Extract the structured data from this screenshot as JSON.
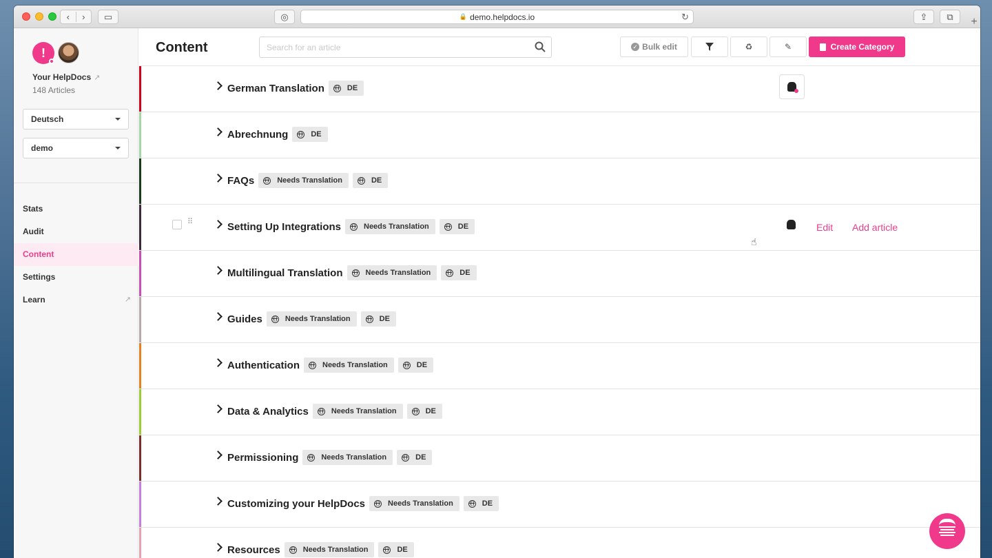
{
  "browser": {
    "url": "demo.helpdocs.io"
  },
  "sidebar": {
    "site_name": "Your HelpDocs",
    "article_count": "148 Articles",
    "language_select": "Deutsch",
    "workspace_select": "demo",
    "nav": [
      {
        "label": "Stats"
      },
      {
        "label": "Audit"
      },
      {
        "label": "Content",
        "active": true
      },
      {
        "label": "Settings"
      },
      {
        "label": "Learn"
      }
    ]
  },
  "header": {
    "title": "Content",
    "search_placeholder": "Search for an article",
    "bulk_edit_label": "Bulk edit",
    "create_label": "Create Category"
  },
  "categories": [
    {
      "title": "German Translation",
      "badges": [
        "DE"
      ],
      "color": "#d0021b"
    },
    {
      "title": "Abrechnung",
      "badges": [
        "DE"
      ],
      "color": "#a5d6a7"
    },
    {
      "title": "FAQs",
      "badges": [
        "Needs Translation",
        "DE"
      ],
      "color": "#1b3a1b"
    },
    {
      "title": "Setting Up Integrations",
      "badges": [
        "Needs Translation",
        "DE"
      ],
      "color": "#3a2a3a",
      "hovered": true,
      "actions": [
        "Edit",
        "Add article"
      ]
    },
    {
      "title": "Multilingual Translation",
      "badges": [
        "Needs Translation",
        "DE"
      ],
      "color": "#c94fb8"
    },
    {
      "title": "Guides",
      "badges": [
        "Needs Translation",
        "DE"
      ],
      "color": "#b8a8a8"
    },
    {
      "title": "Authentication",
      "badges": [
        "Needs Translation",
        "DE"
      ],
      "color": "#e67e22"
    },
    {
      "title": "Data & Analytics",
      "badges": [
        "Needs Translation",
        "DE"
      ],
      "color": "#9acd32"
    },
    {
      "title": "Permissioning",
      "badges": [
        "Needs Translation",
        "DE"
      ],
      "color": "#7b2d2d"
    },
    {
      "title": "Customizing your HelpDocs",
      "badges": [
        "Needs Translation",
        "DE"
      ],
      "color": "#c77dde"
    },
    {
      "title": "Resources",
      "badges": [
        "Needs Translation",
        "DE"
      ],
      "color": "#e8a0b0"
    }
  ],
  "icons": {
    "filter": "filter-icon",
    "recycle": "recycle-icon",
    "pencil": "pencil-icon",
    "globe": "globe-icon"
  },
  "colors": {
    "accent": "#f0398b"
  }
}
